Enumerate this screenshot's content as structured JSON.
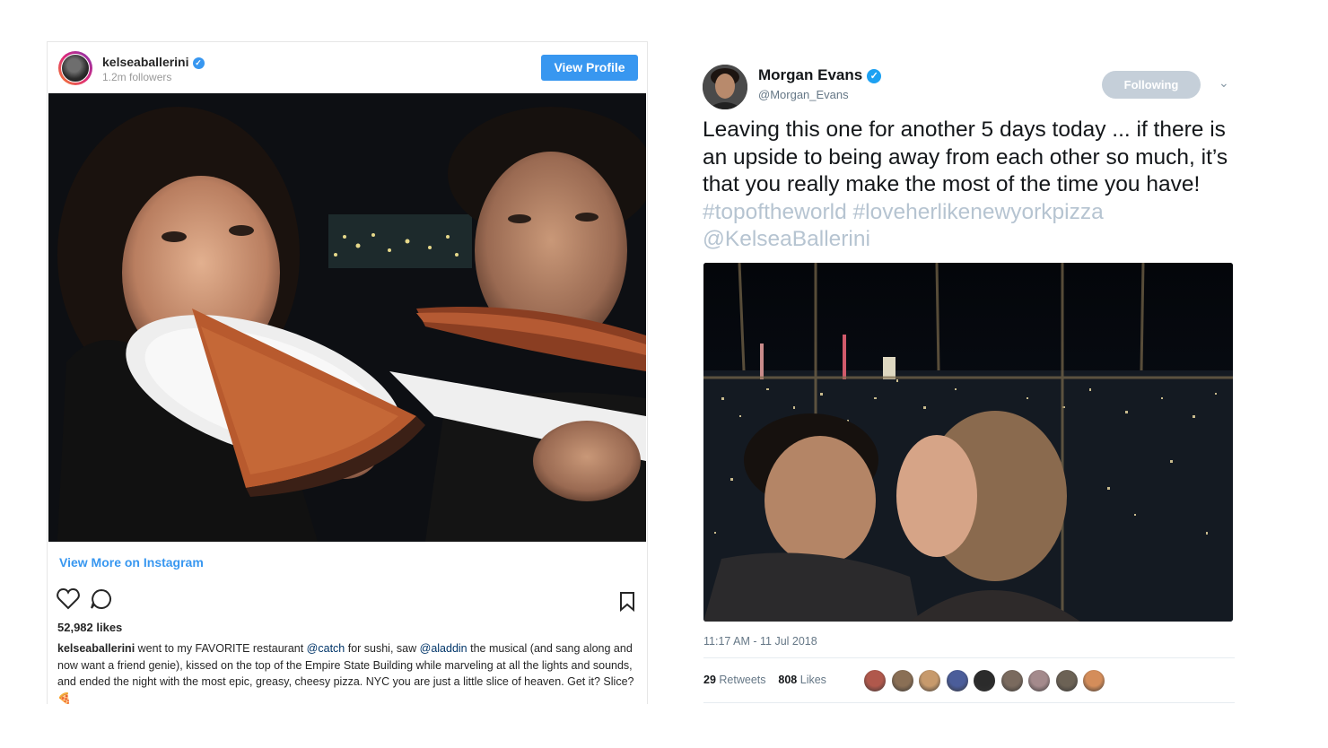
{
  "instagram": {
    "username": "kelseaballerini",
    "followers": "1.2m followers",
    "view_profile_label": "View Profile",
    "view_more_label": "View More on Instagram",
    "likes": "52,982 likes",
    "caption": {
      "user": "kelseaballerini",
      "part1": " went to my FAVORITE restaurant ",
      "mention1": "@catch",
      "part2": " for sushi, saw ",
      "mention2": "@aladdin",
      "part3": " the musical (and sang along and now want a friend genie), kissed on the top of the Empire State Building while marveling at all the lights and sounds, and ended the night with the most epic, greasy, cheesy pizza. NYC you are just a little slice of heaven. Get it? Slice?",
      "emoji": "🍕"
    },
    "icons": [
      "heart-icon",
      "comment-icon",
      "bookmark-icon"
    ]
  },
  "tweet": {
    "name": "Morgan Evans",
    "handle": "@Morgan_Evans",
    "following_label": "Following",
    "text": "Leaving this one for another 5 days today ... if there is an upside to being away from each other so much, it’s that you really make the most of the time you have! ",
    "hashtag1": "#topoftheworld",
    "hashtag2": "#loveherlikenewyorkpizza",
    "mention": "@KelseaBallerini",
    "timestamp": "11:17 AM - 11 Jul 2018",
    "retweets_count": "29",
    "retweets_label": "Retweets",
    "likes_count": "808",
    "likes_label": "Likes",
    "facepile_colors": [
      "#b0584c",
      "#8a6f55",
      "#c79a6c",
      "#4b5d9a",
      "#2b2b2b",
      "#7a6a5e",
      "#a48a8c",
      "#6c6255",
      "#d48d5a"
    ]
  }
}
